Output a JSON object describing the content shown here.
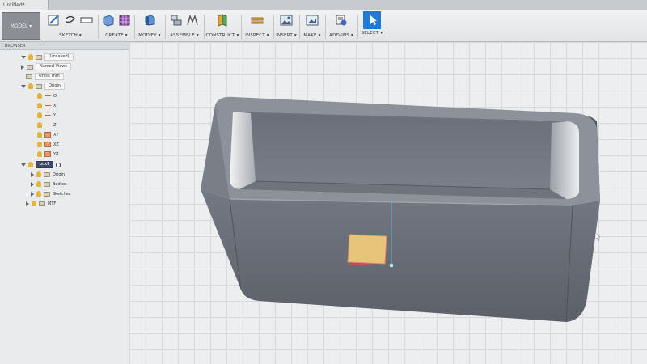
{
  "window": {
    "tab_title": "Untitled*"
  },
  "toolbar": {
    "workspace": "MODEL ▾",
    "groups": [
      {
        "key": "sketch",
        "label": "SKETCH ▾"
      },
      {
        "key": "create",
        "label": "CREATE ▾"
      },
      {
        "key": "modify",
        "label": "MODIFY ▾"
      },
      {
        "key": "assemble",
        "label": "ASSEMBLE ▾"
      },
      {
        "key": "construct",
        "label": "CONSTRUCT ▾"
      },
      {
        "key": "inspect",
        "label": "INSPECT ▾"
      },
      {
        "key": "insert",
        "label": "INSERT ▾"
      },
      {
        "key": "make",
        "label": "MAKE ▾"
      },
      {
        "key": "addins",
        "label": "ADD-INS ▾"
      },
      {
        "key": "select",
        "label": "SELECT ▾"
      }
    ],
    "icons": [
      "sketch-icon",
      "create-box-icon",
      "modify-icon",
      "assemble-icon",
      "construct-plane-icon",
      "measure-icon",
      "insert-image-icon",
      "make-3dprint-icon",
      "add-ins-icon",
      "select-arrow-icon"
    ],
    "accent_color": "#1f7ad6"
  },
  "browser": {
    "title": "BROWSER",
    "items": [
      {
        "label": "(Unsaved)",
        "icon": "document-icon"
      },
      {
        "label": "Named Views",
        "icon": "folder-icon"
      },
      {
        "label": "Units: mm",
        "icon": "units-icon"
      },
      {
        "label": "Origin",
        "icon": "folder-icon"
      },
      {
        "label": "O",
        "icon": "origin-point-icon"
      },
      {
        "label": "X",
        "icon": "axis-icon"
      },
      {
        "label": "Y",
        "icon": "axis-icon"
      },
      {
        "label": "Z",
        "icon": "axis-icon"
      },
      {
        "label": "XY",
        "icon": "plane-icon"
      },
      {
        "label": "XZ",
        "icon": "plane-icon"
      },
      {
        "label": "YZ",
        "icon": "plane-icon"
      },
      {
        "label": "box1",
        "icon": "component-icon"
      },
      {
        "label": "Origin",
        "icon": "folder-icon"
      },
      {
        "label": "Bodies",
        "icon": "folder-icon"
      },
      {
        "label": "Sketches",
        "icon": "folder-icon"
      },
      {
        "label": "MTF",
        "icon": "component-icon"
      }
    ]
  },
  "canvas": {
    "grid": true,
    "model": "open rectangular box",
    "body_color": "#6c7079",
    "sketch_color": "#e8c47a"
  }
}
